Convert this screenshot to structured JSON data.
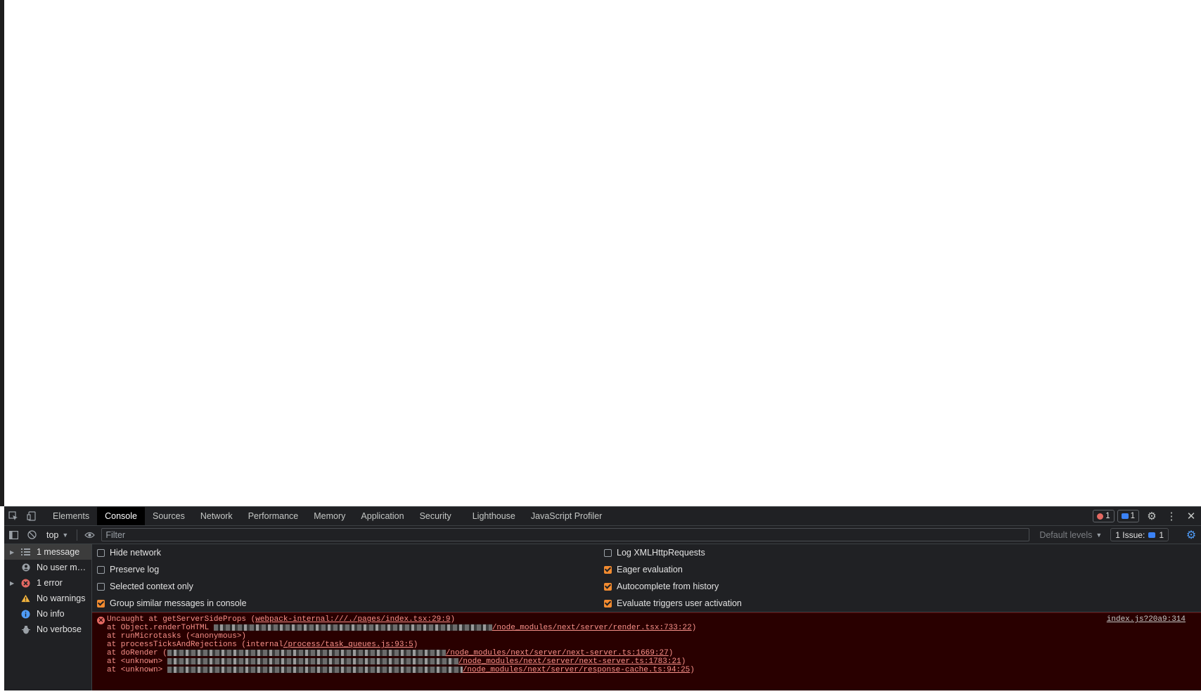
{
  "devtools": {
    "tabs": [
      "Elements",
      "Console",
      "Sources",
      "Network",
      "Performance",
      "Memory",
      "Application",
      "Security",
      "Lighthouse",
      "JavaScript Profiler"
    ],
    "active_tab": "Console",
    "error_count": "1",
    "message_count": "1"
  },
  "toolbar": {
    "context": "top",
    "filter_placeholder": "Filter",
    "levels_label": "Default levels",
    "issues_label": "1 Issue:",
    "issues_count": "1"
  },
  "sidebar": {
    "items": [
      {
        "label": "1 message",
        "icon": "list-icon",
        "expandable": true
      },
      {
        "label": "No user mes...",
        "icon": "user-icon",
        "expandable": false
      },
      {
        "label": "1 error",
        "icon": "error-icon",
        "expandable": true
      },
      {
        "label": "No warnings",
        "icon": "warning-icon",
        "expandable": false
      },
      {
        "label": "No info",
        "icon": "info-icon",
        "expandable": false
      },
      {
        "label": "No verbose",
        "icon": "verbose-icon",
        "expandable": false
      }
    ]
  },
  "settings": {
    "hide_network": {
      "label": "Hide network",
      "checked": false
    },
    "preserve_log": {
      "label": "Preserve log",
      "checked": false
    },
    "selected_context": {
      "label": "Selected context only",
      "checked": false
    },
    "group_similar": {
      "label": "Group similar messages in console",
      "checked": true
    },
    "log_xhr": {
      "label": "Log XMLHttpRequests",
      "checked": false
    },
    "eager_eval": {
      "label": "Eager evaluation",
      "checked": true
    },
    "autocomplete": {
      "label": "Autocomplete from history",
      "checked": true
    },
    "evaluate_triggers": {
      "label": "Evaluate triggers user activation",
      "checked": true
    }
  },
  "error": {
    "source_link": "index.js?20a9:314",
    "line1_prefix": "Uncaught     at getServerSideProps (",
    "line1_link": "webpack-internal:///./pages/index.tsx:29:9",
    "line1_suffix": ")",
    "line2_prefix": "    at Object.renderToHTML ",
    "line2_link": "/node_modules/next/server/render.tsx:733:22",
    "line2_suffix": ")",
    "line3": "    at runMicrotasks (<anonymous>)",
    "line4_prefix": "    at processTicksAndRejections (internal",
    "line4_link": "/process/task_queues.js:93:5",
    "line4_suffix": ")",
    "line5_prefix": "    at doRender (",
    "line5_link": "/node_modules/next/server/next-server.ts:1669:27",
    "line5_suffix": ")",
    "line6_prefix": "    at <unknown> ",
    "line6_link": "/node_modules/next/server/next-server.ts:1783:21",
    "line6_suffix": ")",
    "line7_prefix": "    at <unknown> ",
    "line7_link": "/node_modules/next/server/response-cache.ts:94:25",
    "line7_suffix": ")"
  },
  "colors": {
    "error_text": "#f9918a",
    "error_bg": "#290000",
    "checkbox_checked": "#f28b30",
    "panel_bg": "#202124"
  }
}
